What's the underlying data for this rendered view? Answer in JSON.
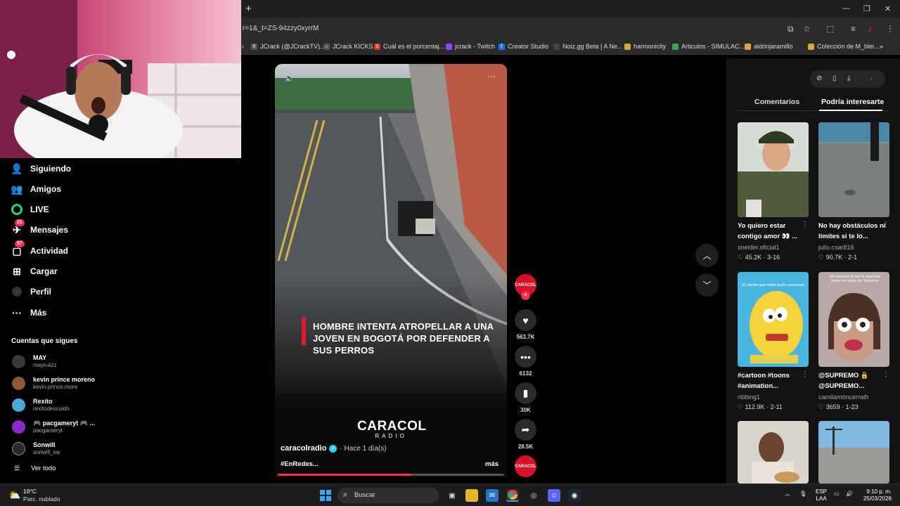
{
  "browser": {
    "new_tab": "+",
    "url": "r=1&_t=ZS-94zzy0xyrrM",
    "window_controls": [
      "minimize-icon",
      "restore-icon",
      "close-icon"
    ],
    "bookmarks": [
      {
        "label": "JCrack (@JCrackTV)...",
        "icon": "x-logo-icon",
        "color": "#000000"
      },
      {
        "label": "JCrack KICKS",
        "icon": "tiktok-icon",
        "color": "#222222"
      },
      {
        "label": "Cuál es el porcentaj...",
        "icon": "s-icon",
        "color": "#d93025"
      },
      {
        "label": "jcrack - Twitch",
        "icon": "twitch-icon",
        "color": "#9146ff"
      },
      {
        "label": "Creator Studio",
        "icon": "facebook-icon",
        "color": "#1877f2"
      },
      {
        "label": "Noiz.gg Beta | A Ne...",
        "icon": "noiz-icon",
        "color": "#444444"
      },
      {
        "label": "harmonicity",
        "icon": "folder-icon",
        "color": "#d8a838"
      },
      {
        "label": "Articulos - SIMULAC...",
        "icon": "drive-icon",
        "color": "#34a853"
      },
      {
        "label": "aldrinjaramillo",
        "icon": "folder-icon",
        "color": "#d8a838"
      },
      {
        "label": "Colección de M_blei...",
        "icon": "folder-icon",
        "color": "#d8a838"
      }
    ],
    "more_bookmarks": "»"
  },
  "nav": {
    "items": [
      {
        "label": "Siguiendo",
        "icon": "following-icon"
      },
      {
        "label": "Amigos",
        "icon": "friends-icon"
      },
      {
        "label": "LIVE",
        "icon": "live-icon"
      },
      {
        "label": "Mensajes",
        "icon": "messages-icon",
        "badge": "21"
      },
      {
        "label": "Actividad",
        "icon": "activity-icon",
        "badge": "57"
      },
      {
        "label": "Cargar",
        "icon": "upload-icon"
      },
      {
        "label": "Perfil",
        "icon": "profile-icon"
      },
      {
        "label": "Más",
        "icon": "more-icon"
      }
    ],
    "following_title": "Cuentas que sigues",
    "following": [
      {
        "name": "MAY",
        "handle": "mayruiizz",
        "color": "#3a3a3a"
      },
      {
        "name": "kevin prince moreno",
        "handle": "kevin.prince.more",
        "color": "#8a5a3a"
      },
      {
        "name": "Rexito",
        "handle": "rexitodescuido",
        "color": "#49a9d8"
      },
      {
        "name": "🎮 pacgameryt 🎮 ...",
        "handle": "pacgameryt",
        "color": "#8a2ac8"
      },
      {
        "name": "Sonwill",
        "handle": "sonwill_sw",
        "color": "#2a2a2a"
      }
    ],
    "see_all": "Ver todo"
  },
  "video": {
    "headline": "HOMBRE INTENTA ATROPELLAR A UNA JOVEN EN BOGOTÁ POR DEFENDER A SUS PERROS",
    "logo_main": "CARACOL",
    "logo_sub": "RADIO",
    "author": "caracolradio",
    "time_ago": "· Hace 1 día(s)",
    "caption": "#EnRedes...",
    "more": "más",
    "progress": 0.59
  },
  "actions": {
    "avatar_label": "CARACOL",
    "likes": "563.7K",
    "comments": "6132",
    "saves": "30K",
    "shares": "28.5K"
  },
  "right_panel": {
    "tabs": [
      "Comentarios",
      "Podría interesarte"
    ],
    "active_tab": 1,
    "cards": [
      {
        "title": "Yo quiero estar contigo amor 👀 ...",
        "author": "sneider.oficial1",
        "likes": "45.2K",
        "date": "3-16",
        "thumb_text": ""
      },
      {
        "title": "No hay obstáculos ni límites si te lo...",
        "author": "julio.csar816",
        "likes": "90.7K",
        "date": "2-1",
        "thumb_text": ""
      },
      {
        "title": "#cartoon #toons #animation...",
        "author": "nbbing1",
        "likes": "112.9K",
        "date": "2-11",
        "thumb_text": "El cliente que nadie pudo convencer"
      },
      {
        "title": "@SUPREMO 🔒 @SUPREMO...",
        "author": "camilamoncerrath",
        "likes": "3659",
        "date": "1-23",
        "thumb_text": "Mi reacción al ver la segunda parte del video de Supremo"
      }
    ]
  },
  "taskbar": {
    "temperature": "19°C",
    "weather": "Parc. nublado",
    "search_placeholder": "Buscar",
    "lang_top": "ESP",
    "lang_bottom": "LAA",
    "time": "9:10 p. m.",
    "date": "25/03/2026"
  },
  "colors": {
    "accent": "#fe2c55",
    "caracol_red": "#d8102a",
    "verified": "#20d5ec"
  }
}
